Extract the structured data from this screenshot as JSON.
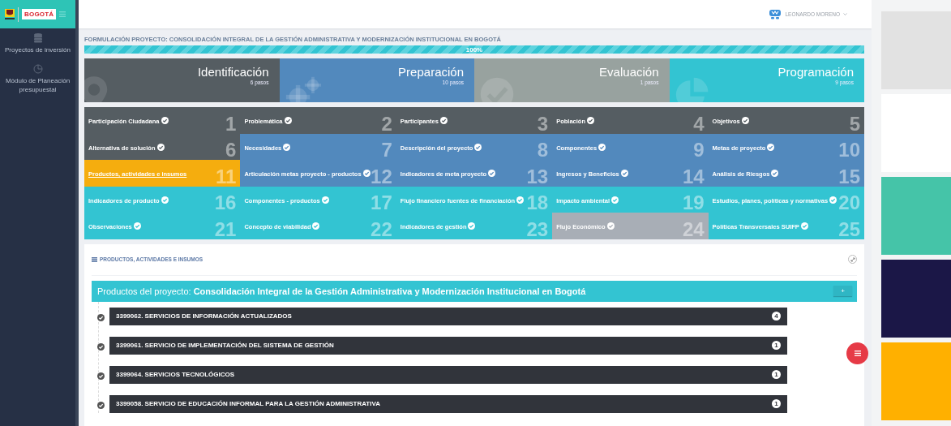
{
  "sidebar": {
    "logo_text": "BOGOTÁ",
    "items": [
      {
        "label": "Proyectos de inversión",
        "kind": "database"
      },
      {
        "label": "Módulo de Planeación presupuestal",
        "kind": "chart"
      }
    ]
  },
  "user": {
    "name": "LEONARDO MORENO"
  },
  "project_title": "FORMULACIÓN PROYECTO: CONSOLIDACIÓN INTEGRAL DE LA GESTIÓN ADMINISTRATIVA Y MODERNIZACIÓN INSTITUCIONAL EN BOGOTÁ",
  "progress": {
    "level": 1,
    "reading": "100%"
  },
  "stages": [
    {
      "name": "Identificación",
      "steps": "6 pasos",
      "color": "#555d62",
      "kind": "pin"
    },
    {
      "name": "Preparación",
      "steps": "10 pasos",
      "color": "#5289bd",
      "kind": "gears"
    },
    {
      "name": "Evaluación",
      "steps": "1 pasos",
      "color": "#98a29f",
      "kind": "check"
    },
    {
      "name": "Programación",
      "steps": "9 pasos",
      "color": "#33c4d2",
      "kind": "pie"
    }
  ],
  "steps": [
    {
      "label": "Participación Ciudadana",
      "number": "1",
      "color": "#555d62",
      "selected": false
    },
    {
      "label": "Problemática",
      "number": "2",
      "color": "#555d62",
      "selected": false
    },
    {
      "label": "Participantes",
      "number": "3",
      "color": "#555d62",
      "selected": false
    },
    {
      "label": "Población",
      "number": "4",
      "color": "#555d62",
      "selected": false
    },
    {
      "label": "Objetivos",
      "number": "5",
      "color": "#555d62",
      "selected": false
    },
    {
      "label": "Alternativa de solución",
      "number": "6",
      "color": "#555d62",
      "selected": false
    },
    {
      "label": "Necesidades",
      "number": "7",
      "color": "#5289bd",
      "selected": false
    },
    {
      "label": "Descripción del proyecto",
      "number": "8",
      "color": "#5289bd",
      "selected": false
    },
    {
      "label": "Componentes",
      "number": "9",
      "color": "#5289bd",
      "selected": false
    },
    {
      "label": "Metas de proyecto",
      "number": "10",
      "color": "#5289bd",
      "selected": false
    },
    {
      "label": "Productos, actividades e insumos",
      "number": "11",
      "color": "#f5ad0e",
      "selected": true
    },
    {
      "label": "Articulación metas proyecto - productos",
      "number": "12",
      "color": "#5289bd",
      "selected": false
    },
    {
      "label": "Indicadores de meta proyecto",
      "number": "13",
      "color": "#5289bd",
      "selected": false
    },
    {
      "label": "Ingresos y Beneficios",
      "number": "14",
      "color": "#5289bd",
      "selected": false
    },
    {
      "label": "Análisis de Riesgos",
      "number": "15",
      "color": "#5289bd",
      "selected": false
    },
    {
      "label": "Indicadores de producto",
      "number": "16",
      "color": "#33c4d2",
      "selected": false
    },
    {
      "label": "Componentes - productos",
      "number": "17",
      "color": "#33c4d2",
      "selected": false
    },
    {
      "label": "Flujo financiero fuentes de financiación",
      "number": "18",
      "color": "#33c4d2",
      "selected": false
    },
    {
      "label": "Impacto ambiental",
      "number": "19",
      "color": "#33c4d2",
      "selected": false
    },
    {
      "label": "Estudios, planes, políticas y normativas",
      "number": "20",
      "color": "#33c4d2",
      "selected": false
    },
    {
      "label": "Observaciones",
      "number": "21",
      "color": "#33c4d2",
      "selected": false
    },
    {
      "label": "Concepto de viabilidad",
      "number": "22",
      "color": "#33c4d2",
      "selected": false
    },
    {
      "label": "Indicadores de gestión",
      "number": "23",
      "color": "#33c4d2",
      "selected": false
    },
    {
      "label": "Flujo Económico",
      "number": "24",
      "color": "#a8aeb6",
      "selected": false
    },
    {
      "label": "Políticas Transversales SUIFP",
      "number": "25",
      "color": "#33c4d2",
      "selected": false
    }
  ],
  "panel": {
    "title": "PRODUCTOS, ACTIVIDADES E INSUMOS",
    "heading": "Productos del proyecto: **Consolidación Integral de la Gestión Administrativa y Modernización Institucional en Bogotá**",
    "add_button": "+",
    "products": [
      {
        "label": "3399062. SERVICIOS DE INFORMACIÓN ACTUALIZADOS",
        "count": "4"
      },
      {
        "label": "3399061. SERVICIO DE IMPLEMENTACIÓN DEL SISTEMA DE GESTIÓN",
        "count": "1"
      },
      {
        "label": "3399064. SERVICIOS TECNOLÓGICOS",
        "count": "1"
      },
      {
        "label": "3399058. SERVICIO DE EDUCACIÓN INFORMAL PARA LA GESTIÓN ADMINISTRATIVA",
        "count": "1"
      }
    ]
  },
  "swatches": [
    {
      "color": "#e2e2e2"
    },
    {
      "color": "#ffffff"
    },
    {
      "color": "#45c4a8"
    },
    {
      "color": "#1b1747"
    },
    {
      "color": "#ffb000"
    }
  ]
}
